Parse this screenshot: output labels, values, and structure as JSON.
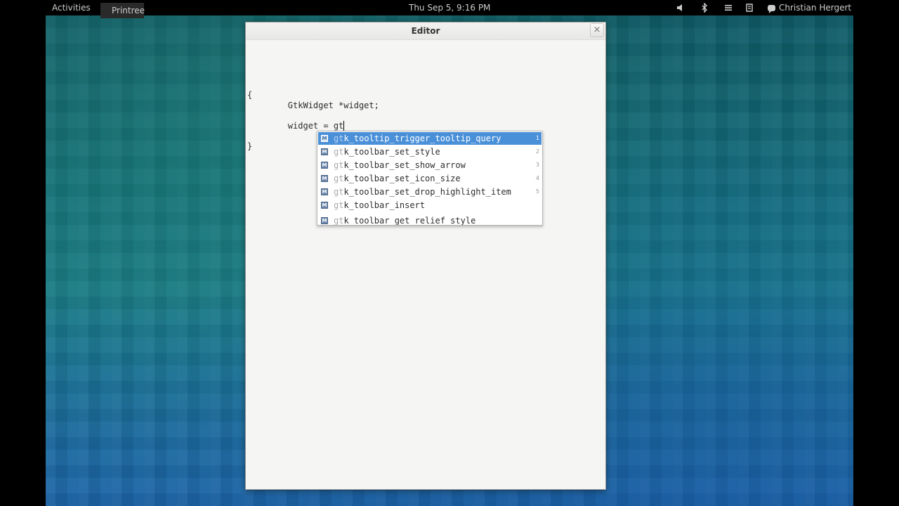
{
  "topbar": {
    "activities": "Activities",
    "app_name": "Printree",
    "clock": "Thu Sep  5,  9:16 PM",
    "user_name": "Christian Hergert",
    "tray_icons": [
      "volume-icon",
      "bluetooth-icon",
      "accessibility-icon",
      "network-icon"
    ]
  },
  "window": {
    "title": "Editor",
    "close_glyph": "×"
  },
  "editor": {
    "lines": [
      "{",
      "        GtkWidget *widget;",
      "",
      "        widget = gt",
      "",
      "}"
    ]
  },
  "completion": {
    "typed_prefix": "gt",
    "selected_index": 0,
    "icon_label": "M",
    "items": [
      {
        "rest": "k_tooltip_trigger_tooltip_query",
        "shortcut": "1"
      },
      {
        "rest": "k_toolbar_set_style",
        "shortcut": "2"
      },
      {
        "rest": "k_toolbar_set_show_arrow",
        "shortcut": "3"
      },
      {
        "rest": "k_toolbar_set_icon_size",
        "shortcut": "4"
      },
      {
        "rest": "k_toolbar_set_drop_highlight_item",
        "shortcut": "5"
      },
      {
        "rest": "k_toolbar_insert",
        "shortcut": ""
      },
      {
        "rest": "k_toolbar_get_relief_style",
        "shortcut": ""
      }
    ]
  },
  "colors": {
    "selection": "#4a90d9",
    "topbar": "#000000",
    "window_bg": "#f5f5f3"
  }
}
